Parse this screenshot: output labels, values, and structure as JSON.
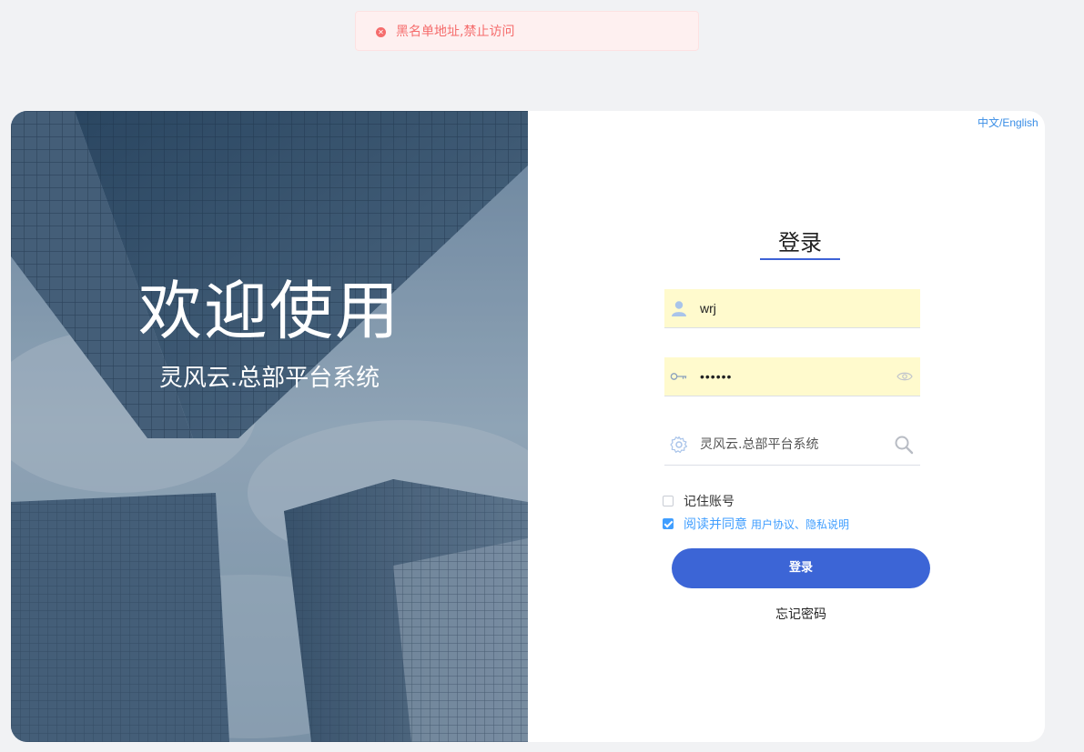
{
  "alert": {
    "icon": "error-circle-icon",
    "message": "黑名单地址,禁止访问",
    "color": "#f56c6c"
  },
  "left_panel": {
    "title": "欢迎使用",
    "subtitle": "灵风云.总部平台系统"
  },
  "header": {
    "language_switch": "中文/English"
  },
  "login": {
    "title": "登录",
    "username": {
      "icon": "user-icon",
      "value": "wrj"
    },
    "password": {
      "icon": "key-icon",
      "value": "••••••",
      "toggle_icon": "eye-icon"
    },
    "system": {
      "icon": "settings-gear-icon",
      "value": "灵风云.总部平台系统",
      "search_icon": "search-icon"
    },
    "remember": {
      "label": "记住账号",
      "checked": false
    },
    "agreement": {
      "label": "阅读并同意",
      "links": "用户协议、隐私说明",
      "checked": true
    },
    "submit_label": "登录",
    "forgot_label": "忘记密码",
    "accent_color": "#3c65d6"
  }
}
